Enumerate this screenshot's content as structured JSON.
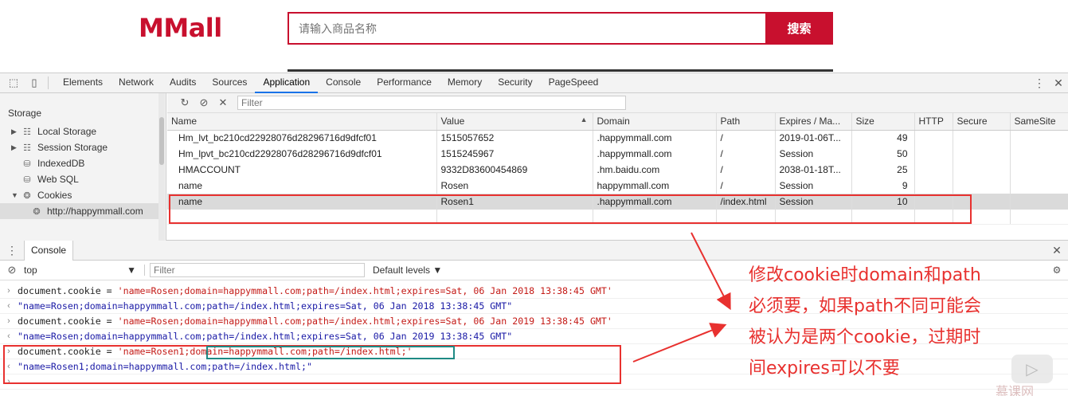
{
  "site": {
    "logo": "MMall",
    "search_placeholder": "请输入商品名称",
    "search_button": "搜索",
    "accent": "#c8102e"
  },
  "devtools": {
    "tabs": [
      "Elements",
      "Network",
      "Audits",
      "Sources",
      "Application",
      "Console",
      "Performance",
      "Memory",
      "Security",
      "PageSpeed"
    ],
    "active_tab": "Application"
  },
  "sidebar": {
    "header": "Storage",
    "items": [
      {
        "label": "Local Storage",
        "icon": "grid-icon"
      },
      {
        "label": "Session Storage",
        "icon": "grid-icon"
      },
      {
        "label": "IndexedDB",
        "icon": "database-icon"
      },
      {
        "label": "Web SQL",
        "icon": "database-icon"
      },
      {
        "label": "Cookies",
        "icon": "cookie-icon"
      },
      {
        "label": "http://happymmall.com",
        "icon": "cookie-icon"
      }
    ]
  },
  "cookies": {
    "filter_placeholder": "Filter",
    "columns": [
      "Name",
      "Value",
      "Domain",
      "Path",
      "Expires / Ma...",
      "Size",
      "HTTP",
      "Secure",
      "SameSite"
    ],
    "rows": [
      [
        "Hm_lvt_bc210cd22928076d28296716d9dfcf01",
        "1515057652",
        ".happymmall.com",
        "/",
        "2019-01-06T...",
        "49",
        "",
        "",
        ""
      ],
      [
        "Hm_lpvt_bc210cd22928076d28296716d9dfcf01",
        "1515245967",
        ".happymmall.com",
        "/",
        "Session",
        "50",
        "",
        "",
        ""
      ],
      [
        "HMACCOUNT",
        "9332D83600454869",
        ".hm.baidu.com",
        "/",
        "2038-01-18T...",
        "25",
        "",
        "",
        ""
      ],
      [
        "name",
        "Rosen",
        "happymmall.com",
        "/",
        "Session",
        "9",
        "",
        "",
        ""
      ],
      [
        "name",
        "Rosen1",
        ".happymmall.com",
        "/index.html",
        "Session",
        "10",
        "",
        "",
        ""
      ]
    ],
    "selected_row": 4
  },
  "console": {
    "tab": "Console",
    "context": "top",
    "filter_placeholder": "Filter",
    "levels": "Default levels ▼",
    "lines": [
      {
        "type": "input",
        "kw": "document.cookie = ",
        "str": "'name=Rosen;domain=happymmall.com;path=/index.html;expires=Sat, 06 Jan 2018 13:38:45 GMT'"
      },
      {
        "type": "result",
        "str": "\"name=Rosen;domain=happymmall.com;path=/index.html;expires=Sat, 06 Jan 2018 13:38:45 GMT\""
      },
      {
        "type": "input",
        "kw": "document.cookie = ",
        "str": "'name=Rosen;domain=happymmall.com;path=/index.html;expires=Sat, 06 Jan 2019 13:38:45 GMT'"
      },
      {
        "type": "result",
        "str": "\"name=Rosen;domain=happymmall.com;path=/index.html;expires=Sat, 06 Jan 2019 13:38:45 GMT\""
      },
      {
        "type": "input",
        "kw": "document.cookie = ",
        "str": "'name=Rosen1;domain=happymmall.com;path=/index.html;'"
      },
      {
        "type": "result",
        "str": "\"name=Rosen1;domain=happymmall.com;path=/index.html;\""
      }
    ]
  },
  "annotation": {
    "lines": [
      "修改cookie时domain和path",
      "必须要，如果path不同可能会",
      "被认为是两个cookie，过期时",
      "间expires可以不要"
    ],
    "color": "#e8312f"
  },
  "watermark": "慕课网"
}
